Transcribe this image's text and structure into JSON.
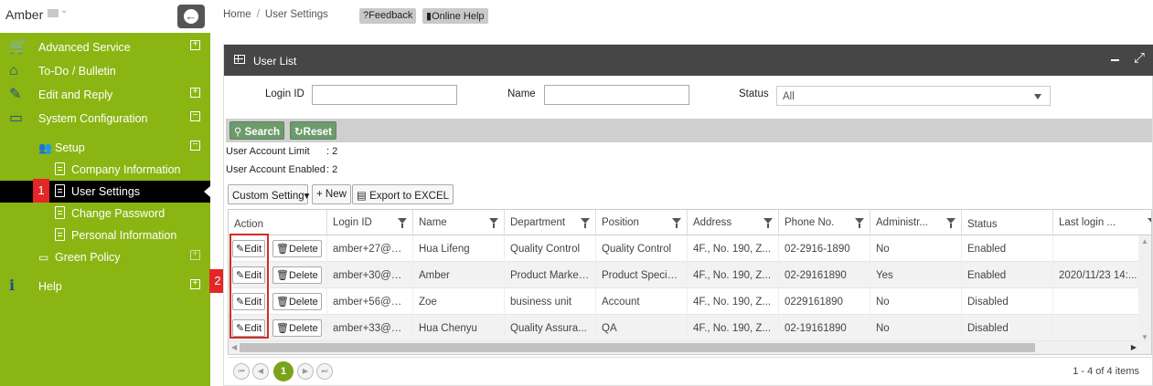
{
  "user": {
    "name": "Amber"
  },
  "sidebar": {
    "items": [
      {
        "label": "Advanced Service",
        "icon": "cart-icon",
        "toggle": "+"
      },
      {
        "label": "To-Do / Bulletin",
        "icon": "home-icon"
      },
      {
        "label": "Edit and Reply",
        "icon": "edit-icon",
        "toggle": "+"
      },
      {
        "label": "System Configuration",
        "icon": "monitor-icon",
        "toggle": "−"
      }
    ],
    "setup": {
      "label": "Setup",
      "toggle": "−"
    },
    "sub_items": [
      {
        "label": "Company Information"
      },
      {
        "label": "User Settings"
      },
      {
        "label": "Change Password"
      },
      {
        "label": "Personal Information"
      }
    ],
    "green_policy": {
      "label": "Green Policy",
      "toggle": "+"
    },
    "help": {
      "label": "Help",
      "toggle": "+"
    }
  },
  "callouts": [
    "1",
    "2"
  ],
  "breadcrumb": {
    "home": "Home",
    "separator": "/",
    "current": "User Settings"
  },
  "top_buttons": {
    "feedback": "?Feedback",
    "online_help": "Online Help"
  },
  "panel": {
    "title": "User List"
  },
  "filters": {
    "login_id_label": "Login ID",
    "name_label": "Name",
    "status_label": "Status",
    "status_value": "All",
    "search": "Search",
    "reset": "Reset"
  },
  "info": {
    "limit_label": "User Account Limit",
    "limit_value": ":  2",
    "enabled_label": "User Account Enabled",
    "enabled_value": ":  2"
  },
  "toolbar": {
    "custom": "Custom Setting",
    "new": "New",
    "export": "Export to EXCEL"
  },
  "table": {
    "columns": [
      "Action",
      "Login ID",
      "Name",
      "Department",
      "Position",
      "Address",
      "Phone No.",
      "Administr...",
      "Status",
      "Last login ..."
    ],
    "action_labels": {
      "edit": "Edit",
      "delete": "Delete"
    },
    "rows": [
      [
        "amber+27@ez...",
        "Hua Lifeng",
        "Quality Control",
        "Quality Control",
        "4F., No. 190, Z...",
        "02-2916-1890",
        "No",
        "Enabled",
        ""
      ],
      [
        "amber+30@ez...",
        "Amber",
        "Product Market...",
        "Product Specia...",
        "4F., No. 190, Z...",
        "02-29161890",
        "Yes",
        "Enabled",
        "2020/11/23 14:..."
      ],
      [
        "amber+56@ez...",
        "Zoe",
        "business unit",
        "Account",
        "4F., No. 190, Z...",
        "0229161890",
        "No",
        "Disabled",
        ""
      ],
      [
        "amber+33@ez...",
        "Hua Chenyu",
        "Quality Assura...",
        "QA",
        "4F., No. 190, Z...",
        "02-19161890",
        "No",
        "Disabled",
        ""
      ]
    ]
  },
  "pager": {
    "current": "1",
    "info": "1 - 4 of 4 items"
  }
}
